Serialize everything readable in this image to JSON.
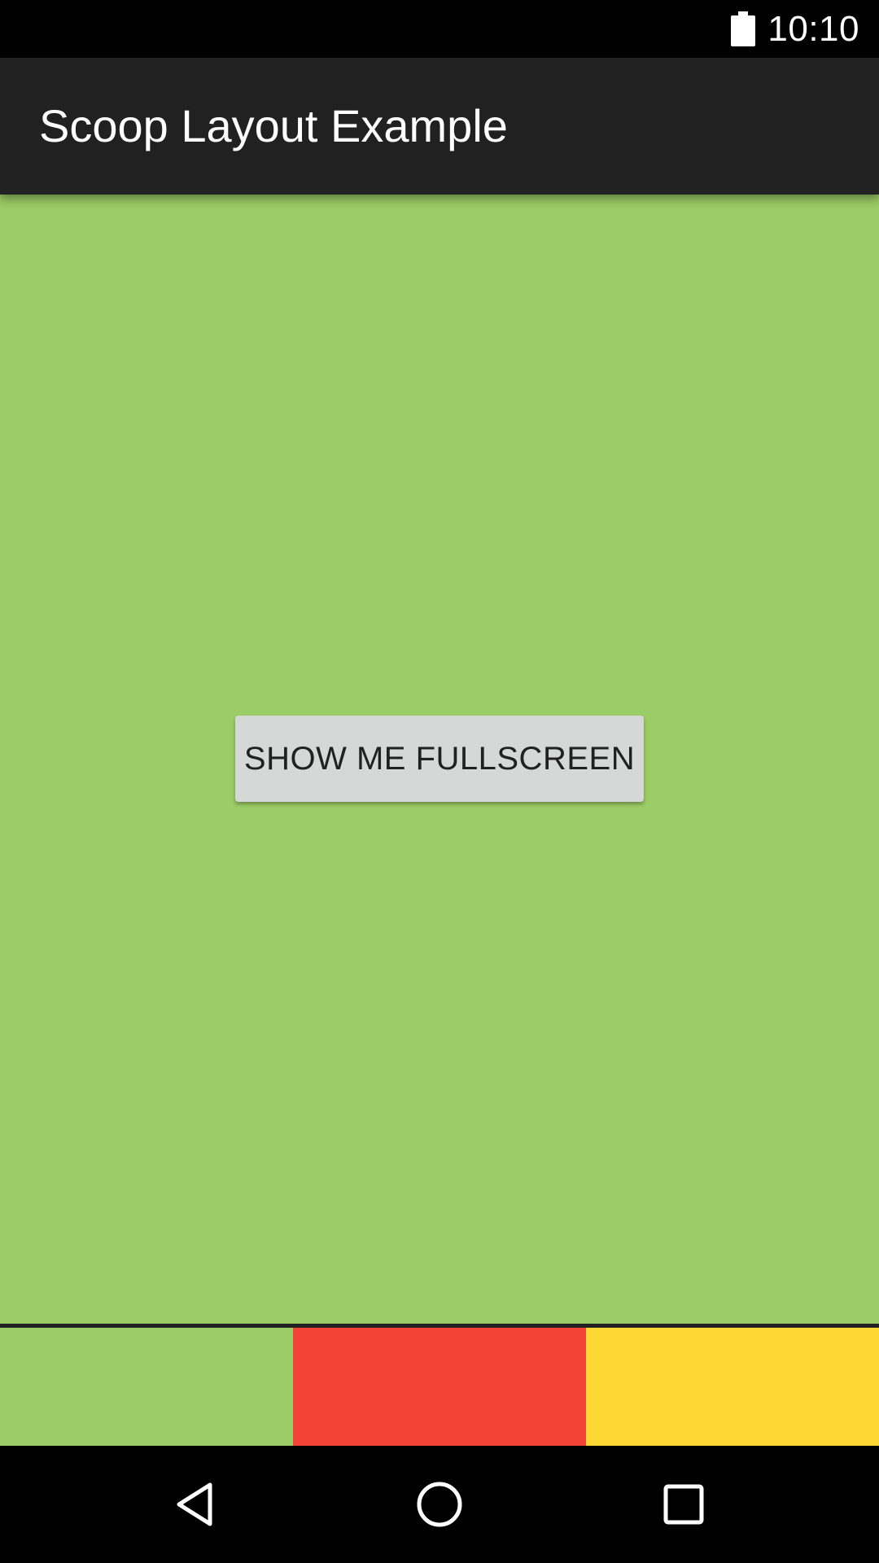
{
  "status_bar": {
    "time": "10:10",
    "battery_icon": "battery-full-icon"
  },
  "app_bar": {
    "title": "Scoop Layout Example"
  },
  "main": {
    "background_color": "#9ccc65",
    "fullscreen_button_label": "SHOW ME FULLSCREEN"
  },
  "color_tabs": [
    {
      "name": "green",
      "color": "#9ccc65"
    },
    {
      "name": "red",
      "color": "#f44336"
    },
    {
      "name": "yellow",
      "color": "#fdd835"
    }
  ],
  "nav_bar": {
    "back_icon": "back-triangle-icon",
    "home_icon": "home-circle-icon",
    "recents_icon": "recents-square-icon"
  }
}
